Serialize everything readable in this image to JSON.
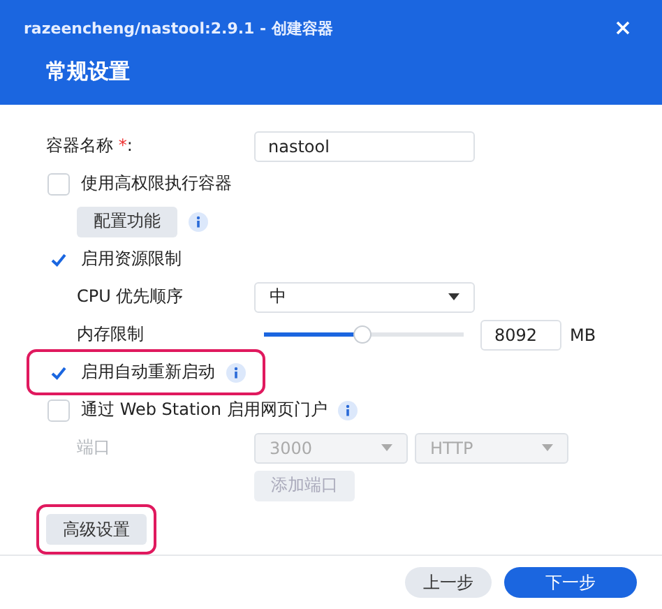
{
  "window": {
    "title": "razeencheng/nastool:2.9.1 - 创建容器"
  },
  "section_title": "常规设置",
  "form": [
    {
      "kind": "text",
      "label": "容器名称",
      "required_mark": "*",
      "colon": ":",
      "value": "nastool"
    },
    {
      "kind": "checkbox",
      "label": "使用高权限执行容器",
      "checked": false,
      "info": false,
      "highlighted": false
    },
    {
      "kind": "button",
      "label": "配置功能",
      "info": true
    },
    {
      "kind": "checkbox",
      "label": "启用资源限制",
      "checked": true,
      "info": false,
      "highlighted": false
    },
    {
      "kind": "select",
      "label": "CPU 优先顺序",
      "value": "中"
    },
    {
      "kind": "slider",
      "label": "内存限制",
      "level": 0.49,
      "value": "8092",
      "unit": "MB"
    },
    {
      "kind": "checkbox",
      "label": "启用自动重新启动",
      "checked": true,
      "info": true,
      "highlighted": true
    },
    {
      "kind": "checkbox",
      "label": "通过 Web Station 启用网页门户",
      "checked": false,
      "info": true,
      "highlighted": false
    },
    {
      "kind": "port",
      "label": "端口",
      "disabled": true,
      "port": "3000",
      "protocol": "HTTP",
      "add_button": "添加端口"
    }
  ],
  "advanced_button": {
    "label": "高级设置",
    "highlighted": true
  },
  "footer_buttons": [
    {
      "label": "上一步",
      "primary": false
    },
    {
      "label": "下一步",
      "primary": true
    }
  ]
}
